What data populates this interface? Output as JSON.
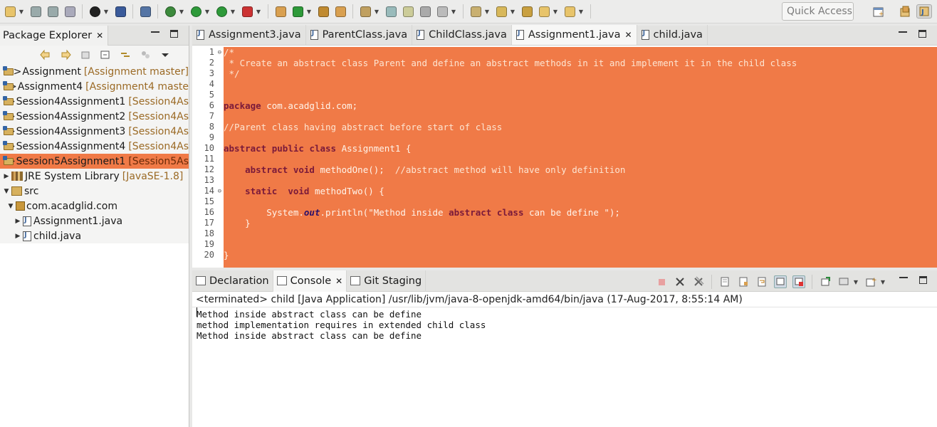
{
  "colors": {
    "selection": "#f07a47",
    "editor_bg": "#f07a47",
    "keyword": "#7a1a3a"
  },
  "toolbar": {
    "quick_access": "Quick Access",
    "icons": [
      "new-icon",
      "save-icon",
      "save-all-icon",
      "print-icon",
      "profile-icon",
      "terminal-icon",
      "skip-breakpoints-icon",
      "debug-icon",
      "run-icon",
      "coverage-icon",
      "external-tools-icon",
      "new-java-project-icon",
      "new-class-icon",
      "open-type-icon",
      "open-folder-icon",
      "search-icon",
      "toggle-mark-occurrences-icon",
      "highlight-icon",
      "toggle-block-icon",
      "show-whitespace-icon",
      "next-annotation-icon",
      "prev-annotation-icon",
      "last-edit-icon",
      "back-icon",
      "forward-icon"
    ]
  },
  "package_explorer": {
    "title": "Package Explorer",
    "items": [
      {
        "indent": 0,
        "kind": "project",
        "name": "Assignment",
        "deco": "[Assignment master]",
        "selected": false
      },
      {
        "indent": 0,
        "kind": "project",
        "name": "Assignment4",
        "deco": "[Assignment4 maste",
        "selected": false
      },
      {
        "indent": 0,
        "kind": "project",
        "name": "Session4Assignment1",
        "deco": "[Session4As",
        "selected": false
      },
      {
        "indent": 0,
        "kind": "project",
        "name": "Session4Assignment2",
        "deco": "[Session4As",
        "selected": false
      },
      {
        "indent": 0,
        "kind": "project",
        "name": "Session4Assignment3",
        "deco": "[Session4As",
        "selected": false
      },
      {
        "indent": 0,
        "kind": "project",
        "name": "Session4Assignment4",
        "deco": "[Session4As",
        "selected": false
      },
      {
        "indent": 0,
        "kind": "project",
        "name": "Session5Assignment1",
        "deco": "[Session5As",
        "selected": true
      },
      {
        "indent": 1,
        "kind": "library",
        "name": "JRE System Library",
        "deco": "[JavaSE-1.8]",
        "selected": false
      },
      {
        "indent": 1,
        "kind": "src",
        "name": "src",
        "deco": "",
        "selected": false
      },
      {
        "indent": 2,
        "kind": "package",
        "name": "com.acadglid.com",
        "deco": "",
        "selected": false
      },
      {
        "indent": 3,
        "kind": "file",
        "name": "Assignment1.java",
        "deco": "",
        "selected": false
      },
      {
        "indent": 3,
        "kind": "file",
        "name": "child.java",
        "deco": "",
        "selected": false
      }
    ]
  },
  "editor": {
    "tabs": [
      {
        "label": "Assignment3.java",
        "active": false
      },
      {
        "label": "ParentClass.java",
        "active": false
      },
      {
        "label": "ChildClass.java",
        "active": false
      },
      {
        "label": "Assignment1.java",
        "active": true
      },
      {
        "label": "child.java",
        "active": false
      }
    ],
    "lines": [
      "/*",
      " * Create an abstract class Parent and define an abstract methods in it and implement it in the child class",
      " */",
      "",
      "",
      "package com.acadglid.com;",
      "",
      "//Parent class having abstract before start of class",
      "",
      "abstract public class Assignment1 {",
      "",
      "    abstract void methodOne();  //abstract method will have only definition",
      "",
      "    static  void methodTwo() {",
      "",
      "        System.out.println(\"Method inside abstract class can be define \");",
      "    }",
      "",
      "",
      "}"
    ],
    "fold_lines": [
      1,
      14
    ]
  },
  "console": {
    "tabs": [
      {
        "label": "Declaration",
        "active": false,
        "closable": false
      },
      {
        "label": "Console",
        "active": true,
        "closable": true
      },
      {
        "label": "Git Staging",
        "active": false,
        "closable": false
      }
    ],
    "status": "<terminated> child [Java Application] /usr/lib/jvm/java-8-openjdk-amd64/bin/java (17-Aug-2017, 8:55:14 AM)",
    "output": [
      "Method inside abstract class can be define",
      "method implementation requires in extended child class",
      "Method inside abstract class can be define"
    ]
  }
}
